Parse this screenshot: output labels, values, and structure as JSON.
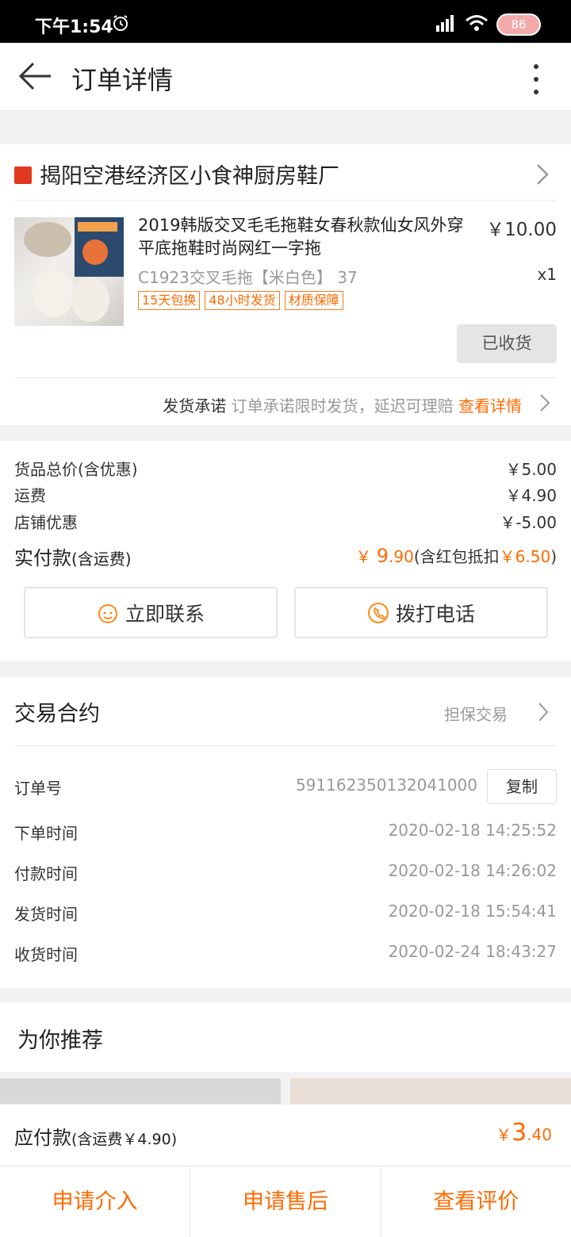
{
  "status_bar": {
    "time": "下午1:54",
    "battery": "86"
  },
  "header": {
    "title": "订单详情"
  },
  "shop": {
    "name": "揭阳空港经济区小食神厨房鞋厂",
    "product": {
      "title": "2019韩版交叉毛毛拖鞋女春秋款仙女风外穿平底拖鞋时尚网红一字拖",
      "price": "￥10.00",
      "spec": "C1923交叉毛拖【米白色】 37",
      "qty": "x1",
      "tags": [
        "15天包换",
        "48小时发货",
        "材质保障"
      ],
      "status_button": "已收货"
    },
    "promise": {
      "label": "发货承诺",
      "text": "订单承诺限时发货，延迟可理赔",
      "link": "查看详情"
    }
  },
  "summary": {
    "rows": [
      {
        "label": "货品总价(含优惠)",
        "value": "￥5.00"
      },
      {
        "label": "运费",
        "value": "￥4.90"
      },
      {
        "label": "店铺优惠",
        "value": "￥-5.00"
      }
    ],
    "paid_label": "实付款",
    "paid_label_sub": "(含运费)",
    "paid_currency": "￥",
    "paid_int": "9",
    "paid_dec": ".90",
    "paid_note_prefix": "(含红包抵扣",
    "paid_note_amount": "￥6.50",
    "paid_note_suffix": ")",
    "contact_button": "立即联系",
    "call_button": "拨打电话"
  },
  "contract": {
    "title": "交易合约",
    "type": "担保交易",
    "order_no_label": "订单号",
    "order_no": "591162350132041000",
    "copy_button": "复制",
    "times": [
      {
        "label": "下单时间",
        "value": "2020-02-18 14:25:52"
      },
      {
        "label": "付款时间",
        "value": "2020-02-18 14:26:02"
      },
      {
        "label": "发货时间",
        "value": "2020-02-18 15:54:41"
      },
      {
        "label": "收货时间",
        "value": "2020-02-24 18:43:27"
      }
    ]
  },
  "recommend": {
    "title": "为你推荐"
  },
  "bottom": {
    "pay_label": "应付款",
    "pay_label_sub": "(含运费￥4.90)",
    "currency": "￥",
    "amount_int": "3",
    "amount_dec": ".40",
    "actions": [
      "申请介入",
      "申请售后",
      "查看评价"
    ]
  },
  "colors": {
    "accent": "#ff6a00",
    "status_bar": "#000000"
  },
  "icons": [
    "alarm-icon",
    "signal-icon",
    "wifi-icon",
    "battery-icon",
    "back-arrow-icon",
    "more-vertical-icon",
    "shop-icon",
    "chevron-right-icon",
    "chat-face-icon",
    "phone-icon"
  ]
}
